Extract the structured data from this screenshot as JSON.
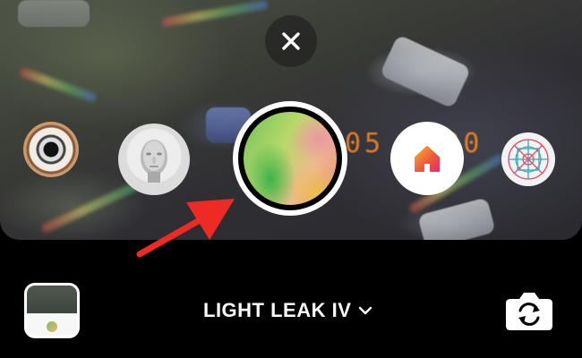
{
  "camera": {
    "overlay_timestamp": "05 0 20"
  },
  "top": {
    "close_icon": "close-icon"
  },
  "effects": [
    {
      "name": "eye",
      "icon": "eye-effect-thumbnail"
    },
    {
      "name": "head",
      "icon": "head-effect-thumbnail"
    },
    {
      "name": "light-leak",
      "icon": "light-leak-effect-thumbnail",
      "selected": true
    },
    {
      "name": "home",
      "icon": "home-icon"
    },
    {
      "name": "pattern",
      "icon": "pattern-effect-thumbnail"
    }
  ],
  "bottom_bar": {
    "effect_name": "LIGHT LEAK IV",
    "dropdown_icon": "chevron-down-icon",
    "gallery_icon": "gallery-thumbnail",
    "flip_icon": "flip-camera-icon"
  },
  "colors": {
    "accent_red": "#ee2a24",
    "home_gradient_start": "#f9b233",
    "home_gradient_end": "#e1306c",
    "selected_ring": "#ffffff",
    "timestamp_orange": "#ff8a1f"
  }
}
